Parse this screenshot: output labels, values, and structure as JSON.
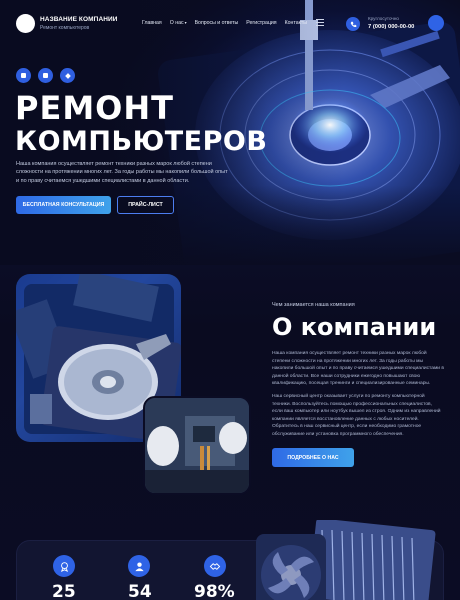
{
  "header": {
    "brand_name": "НАЗВАНИЕ КОМПАНИИ",
    "brand_sub": "Ремонт компьютеров",
    "nav": [
      {
        "label": "Главная"
      },
      {
        "label": "О нас"
      },
      {
        "label": "Вопросы и ответы"
      },
      {
        "label": "Регистрация"
      },
      {
        "label": "Контакты"
      }
    ],
    "phone_label": "Круглосуточно",
    "phone_number": "7 (000) 000-00-00"
  },
  "hero": {
    "title_line1": "РЕМОНТ",
    "title_line2": "КОМПЬЮТЕРОВ",
    "description": "Наша компания осуществляет ремонт техники разных марок любой степени сложности на протяжении многих лет. За годы работы мы накопили большой опыт и по праву считаемся ушедшими специалистами в данной области.",
    "primary_button": "БЕСПЛАТНАЯ КОНСУЛЬТАЦИЯ",
    "secondary_button": "ПРАЙС-ЛИСТ"
  },
  "about": {
    "kicker": "Чем занимается наша компания",
    "title": "О компании",
    "paragraph1": "Наша компания осуществляет ремонт техники разных марок любой степени сложности на протяжении многих лет. За годы работы мы накопили большой опыт и по праву считаемся ушедшими специалистами в данной области. Все наши сотрудники ежегодно повышают свою квалификацию, посещая тренинги и специализированные семинары.",
    "paragraph2": "Наш сервисный центр оказывает услуги по ремонту компьютерной техники. Воспользуйтесь помощью профессиональных специалистов, если ваш компьютер или ноутбук вышел из строя. Одним из направлений компании является восстановление данных с любых носителей. Обратитесь в наш сервисный центр, если необходимо грамотное обслуживание или установка программного обеспечения.",
    "button": "ПОДРОБНЕЕ О НАС"
  },
  "stats": [
    {
      "value": "25",
      "icon": "award-icon"
    },
    {
      "value": "54",
      "icon": "user-icon"
    },
    {
      "value": "98%",
      "icon": "handshake-icon"
    }
  ],
  "colors": {
    "accent": "#2f63e6",
    "accent_light": "#3fa2ea",
    "background": "#0a0c22"
  }
}
